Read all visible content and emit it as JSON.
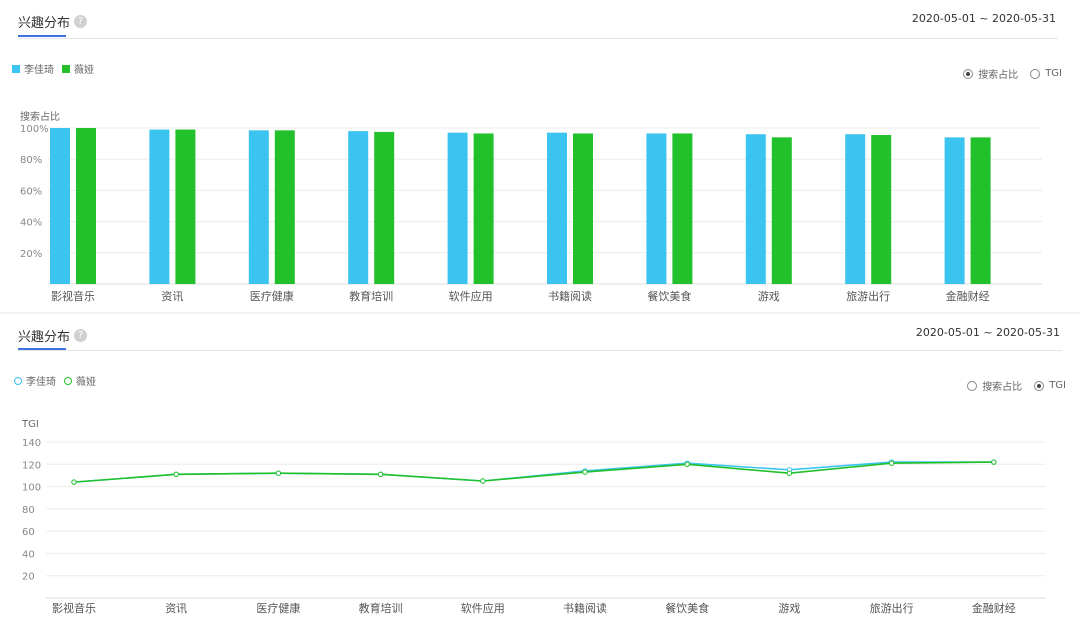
{
  "panels": [
    {
      "title": "兴趣分布",
      "help_icon": "?",
      "date_range": "2020-05-01 ~ 2020-05-31",
      "legend": [
        "李佳琦",
        "薇娅"
      ],
      "radio_options": [
        {
          "label": "搜索占比",
          "selected": true
        },
        {
          "label": "TGI",
          "selected": false
        }
      ],
      "y_axis_title": "搜索占比"
    },
    {
      "title": "兴趣分布",
      "help_icon": "?",
      "date_range": "2020-05-01 ~ 2020-05-31",
      "legend": [
        "李佳琦",
        "薇娅"
      ],
      "radio_options": [
        {
          "label": "搜索占比",
          "selected": false
        },
        {
          "label": "TGI",
          "selected": true
        }
      ],
      "y_axis_title": "TGI"
    }
  ],
  "colors": {
    "series_a": "#3cc4f0",
    "series_b": "#22c02a",
    "grid": "#ececec",
    "axis_text": "#888888",
    "accent": "#3b72e0"
  },
  "chart_data": [
    {
      "type": "bar",
      "ylabel": "搜索占比",
      "categories": [
        "影视音乐",
        "资讯",
        "医疗健康",
        "教育培训",
        "软件应用",
        "书籍阅读",
        "餐饮美食",
        "游戏",
        "旅游出行",
        "金融财经"
      ],
      "yticks": [
        "20%",
        "40%",
        "60%",
        "80%",
        "100%"
      ],
      "ylim": [
        0,
        100
      ],
      "unit": "%",
      "series": [
        {
          "name": "李佳琦",
          "values": [
            100,
            99,
            98.5,
            98,
            97,
            97,
            96.5,
            96,
            96,
            94
          ]
        },
        {
          "name": "薇娅",
          "values": [
            100,
            99,
            98.5,
            97.5,
            96.5,
            96.5,
            96.5,
            94,
            95.5,
            94
          ]
        }
      ]
    },
    {
      "type": "line",
      "ylabel": "TGI",
      "categories": [
        "影视音乐",
        "资讯",
        "医疗健康",
        "教育培训",
        "软件应用",
        "书籍阅读",
        "餐饮美食",
        "游戏",
        "旅游出行",
        "金融财经"
      ],
      "yticks": [
        "20",
        "40",
        "60",
        "80",
        "100",
        "120",
        "140"
      ],
      "ylim": [
        0,
        140
      ],
      "series": [
        {
          "name": "李佳琦",
          "values": [
            104,
            111,
            112,
            111,
            105,
            114,
            121,
            115,
            122,
            122
          ]
        },
        {
          "name": "薇娅",
          "values": [
            104,
            111,
            112,
            111,
            105,
            113,
            120,
            112,
            121,
            122
          ]
        }
      ]
    }
  ]
}
